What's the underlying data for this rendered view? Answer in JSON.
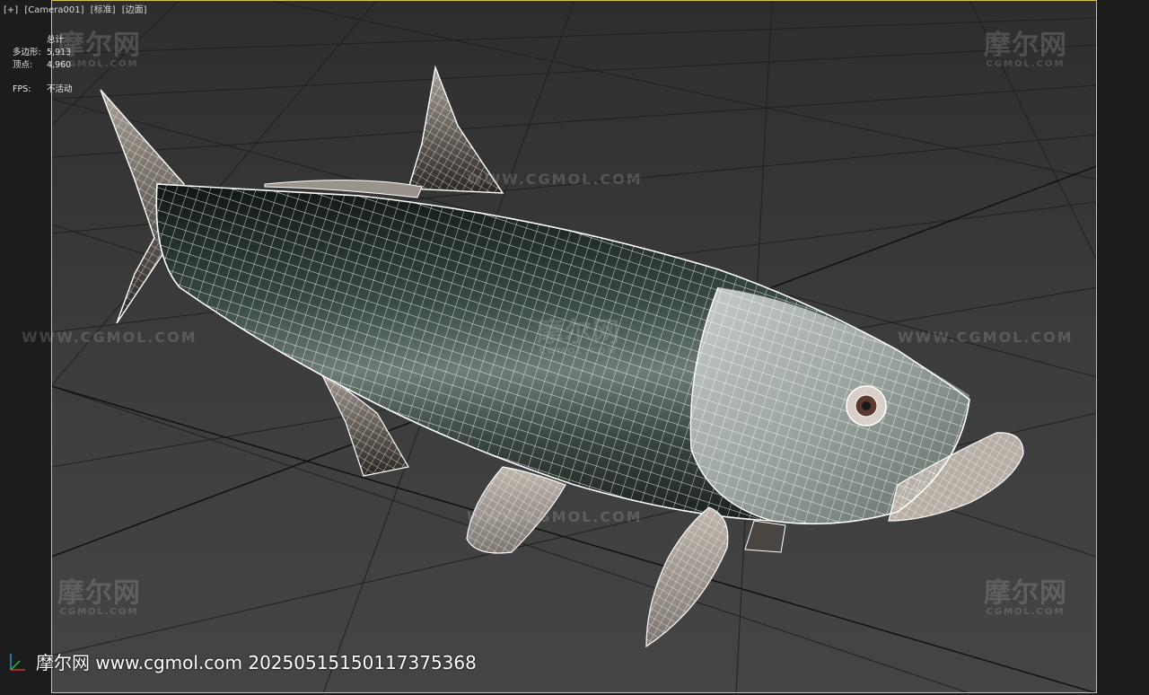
{
  "viewport": {
    "label_plus": "[+]",
    "label_camera": "[Camera001]",
    "label_shading": "[标准]",
    "label_display": "[边面]"
  },
  "stats": {
    "total_label": "总计",
    "polys_label": "多边形:",
    "polys_value": "5,913",
    "verts_label": "顶点:",
    "verts_value": "4,960",
    "fps_label": "FPS:",
    "fps_value": "不活动"
  },
  "watermark": {
    "logo_text": "摩尔网",
    "logo_sub": "CGMOL.COM",
    "url_text": "WWW.CGMOL.COM"
  },
  "footer": {
    "text": "摩尔网 www.cgmol.com 20250515150117375368"
  },
  "colors": {
    "frame": "#d8c84a",
    "viewport_bg": "#3a3a3a",
    "grid": "#1a1a1a",
    "wire": "#ffffff"
  }
}
